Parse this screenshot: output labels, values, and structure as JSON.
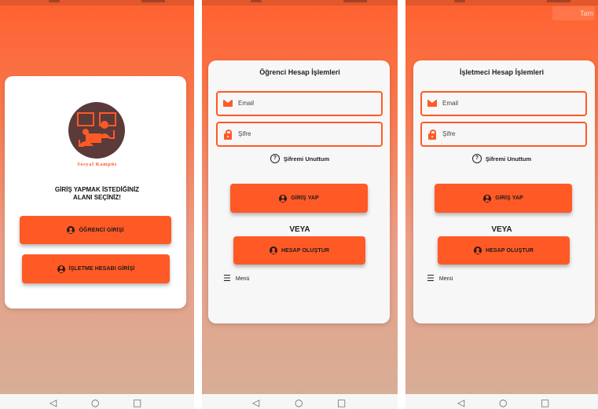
{
  "screen1": {
    "logo_text": "Sosyal Kampüs",
    "prompt_line1": "GİRİŞ YAPMAK İSTEDİĞİNİZ",
    "prompt_line2": "ALANI SEÇİNİZ!",
    "student_login_label": "ÖĞRENCİ GİRİŞİ",
    "business_login_label": "İŞLETME HESABI GİRİŞİ"
  },
  "screen2": {
    "title": "Öğrenci Hesap İşlemleri",
    "email_placeholder": "Email",
    "password_placeholder": "Şifre",
    "forgot_label": "Şifremi Unuttum",
    "login_label": "GİRİŞ YAP",
    "or_label": "VEYA",
    "create_label": "HESAP OLUŞTUR",
    "menu_label": "Menü"
  },
  "screen3": {
    "title": "İşletmeci Hesap İşlemleri",
    "email_placeholder": "Email",
    "password_placeholder": "Şifre",
    "forgot_label": "Şifremi Unuttum",
    "login_label": "GİRİŞ YAP",
    "or_label": "VEYA",
    "create_label": "HESAP OLUŞTUR",
    "menu_label": "Menü",
    "overlay_text": "Tam"
  },
  "icons": {
    "account": "account-circle-icon",
    "email": "email-icon",
    "lock": "lock-icon",
    "help": "help-circle-icon",
    "menu": "menu-open-icon",
    "nav_back": "◁",
    "nav_home": "○",
    "nav_recents": "□"
  },
  "colors": {
    "accent": "#ff5a26",
    "logo_bg": "#5b3a3a"
  }
}
